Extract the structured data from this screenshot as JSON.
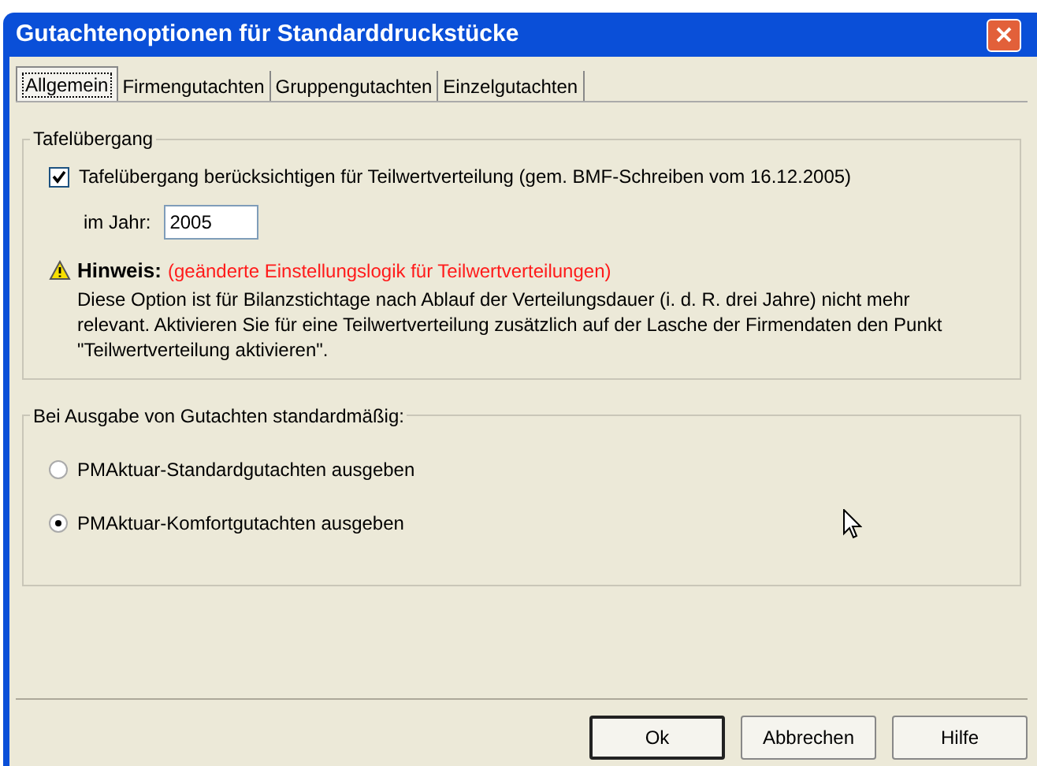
{
  "window": {
    "title": "Gutachtenoptionen für Standarddruckstücke"
  },
  "tabs": [
    {
      "label": "Allgemein",
      "selected": true
    },
    {
      "label": "Firmengutachten",
      "selected": false
    },
    {
      "label": "Gruppengutachten",
      "selected": false
    },
    {
      "label": "Einzelgutachten",
      "selected": false
    }
  ],
  "group_tafel": {
    "title": "Tafelübergang",
    "checkbox": {
      "label": "Tafelübergang berücksichtigen für Teilwertverteilung (gem. BMF-Schreiben vom 16.12.2005)",
      "checked": true
    },
    "year": {
      "label": "im Jahr:",
      "value": "2005"
    },
    "note": {
      "heading": "Hinweis:",
      "subtitle": "(geänderte Einstellungslogik für Teilwertverteilungen)",
      "text": "Diese Option ist für Bilanzstichtage nach Ablauf der Verteilungsdauer (i. d. R. drei Jahre) nicht mehr relevant. Aktivieren Sie für eine Teilwertverteilung zusätzlich auf der Lasche der Firmendaten den Punkt \"Teilwertverteilung aktivieren\"."
    }
  },
  "group_ausgabe": {
    "title": "Bei Ausgabe von Gutachten standardmäßig:",
    "options": [
      {
        "label": "PMAktuar-Standardgutachten ausgeben",
        "selected": false
      },
      {
        "label": "PMAktuar-Komfortgutachten ausgeben",
        "selected": true
      }
    ]
  },
  "buttons": [
    {
      "label": "Ok",
      "kind": "default"
    },
    {
      "label": "Abbrechen",
      "kind": "normal"
    },
    {
      "label": "Hilfe",
      "kind": "normal"
    }
  ]
}
